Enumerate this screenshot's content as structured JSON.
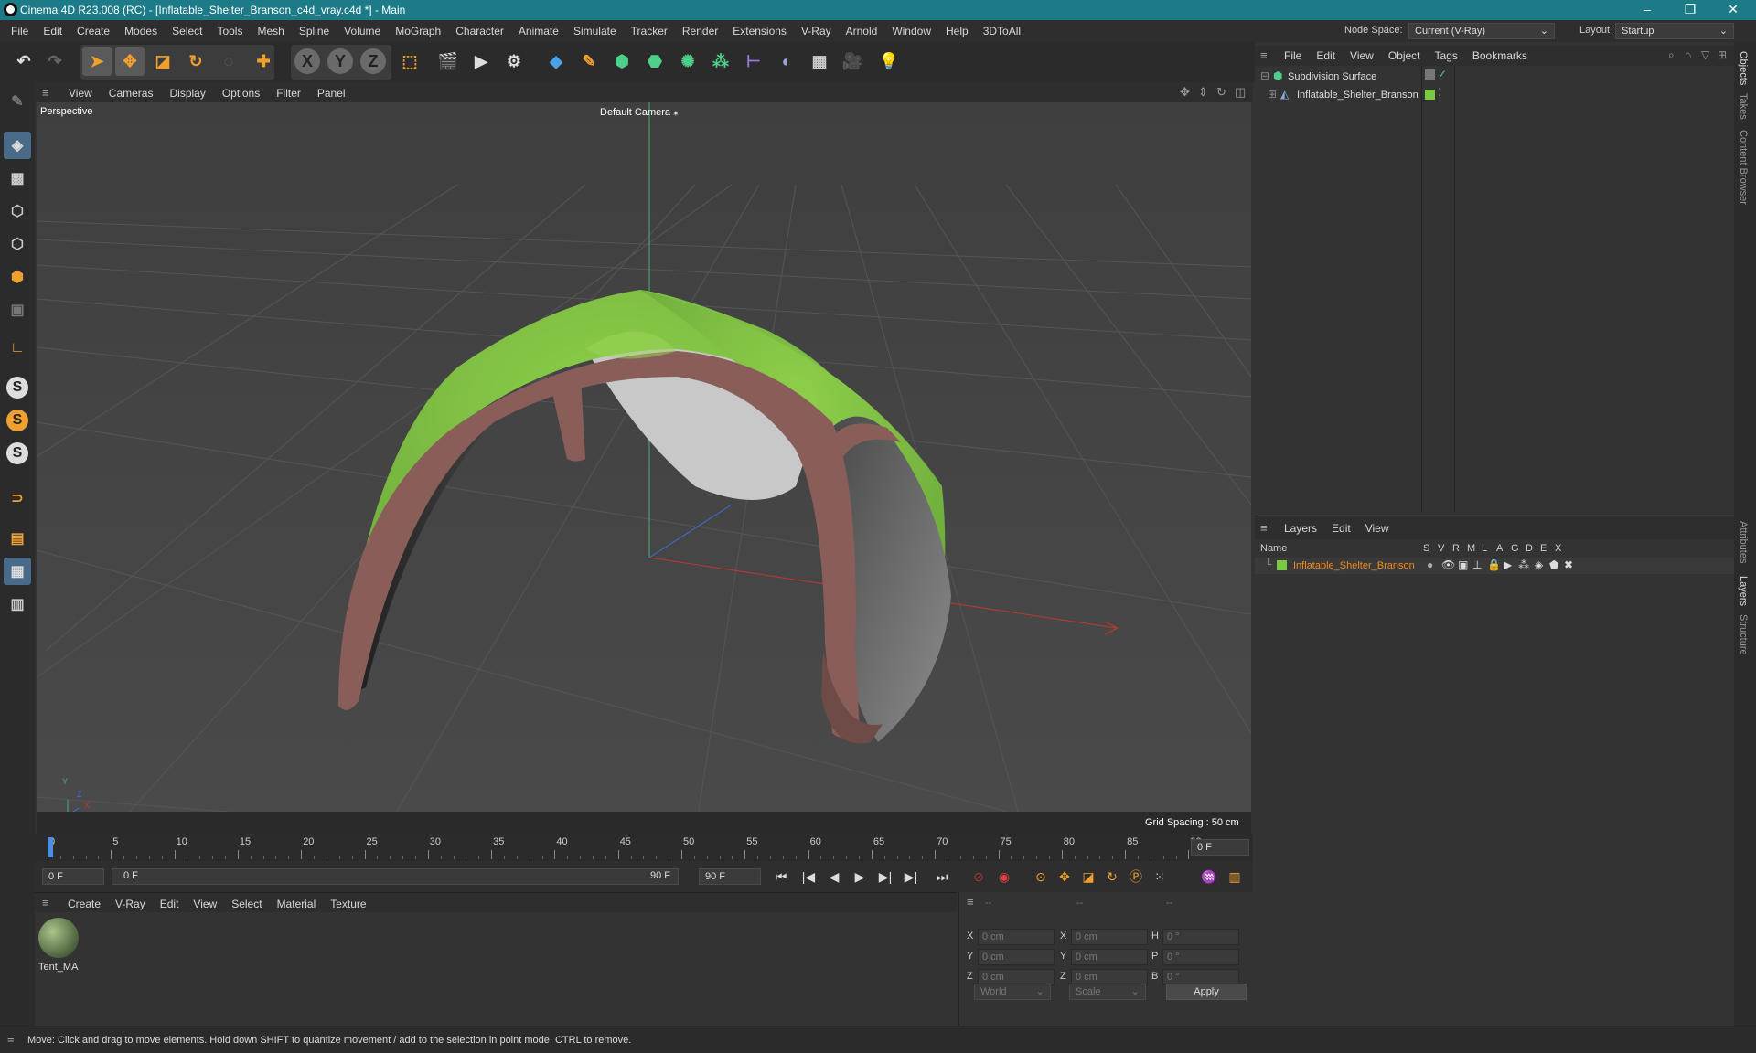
{
  "window": {
    "title": "Cinema 4D R23.008 (RC) - [Inflatable_Shelter_Branson_c4d_vray.c4d *] - Main",
    "min": "–",
    "max": "❐",
    "close": "✕"
  },
  "menubar": {
    "items": [
      "File",
      "Edit",
      "Create",
      "Modes",
      "Select",
      "Tools",
      "Mesh",
      "Spline",
      "Volume",
      "MoGraph",
      "Character",
      "Animate",
      "Simulate",
      "Tracker",
      "Render",
      "Extensions",
      "V-Ray",
      "Arnold",
      "Window",
      "Help",
      "3DToAll"
    ],
    "node_space_label": "Node Space:",
    "node_space_value": "Current (V-Ray)",
    "layout_label": "Layout:",
    "layout_value": "Startup"
  },
  "toolbar": {
    "axis_x": "X",
    "axis_y": "Y",
    "axis_z": "Z"
  },
  "leftbar": {
    "s1": "S",
    "s2": "S",
    "s3": "S"
  },
  "viewport": {
    "menu": [
      "View",
      "Cameras",
      "Display",
      "Options",
      "Filter",
      "Panel"
    ],
    "view_name": "Perspective",
    "camera": "Default Camera",
    "grid_spacing": "Grid Spacing : 50 cm",
    "axis_y": "Y",
    "axis_z": "Z",
    "axis_x": "X"
  },
  "timeline": {
    "ticks": [
      "0",
      "5",
      "10",
      "15",
      "20",
      "25",
      "30",
      "35",
      "40",
      "45",
      "50",
      "55",
      "60",
      "65",
      "70",
      "75",
      "80",
      "85",
      "90"
    ],
    "frame_end_field": "0 F"
  },
  "transport": {
    "start_field": "0 F",
    "range_start": "0 F",
    "range_end": "90 F",
    "end_field": "90 F"
  },
  "material_manager": {
    "menu": [
      "Create",
      "V-Ray",
      "Edit",
      "View",
      "Select",
      "Material",
      "Texture"
    ],
    "materials": [
      {
        "name": "Tent_MA"
      }
    ]
  },
  "coordinates": {
    "header": [
      "--",
      "--",
      "--"
    ],
    "rows": [
      {
        "l1": "X",
        "v1": "0 cm",
        "l2": "X",
        "v2": "0 cm",
        "l3": "H",
        "v3": "0 °"
      },
      {
        "l1": "Y",
        "v1": "0 cm",
        "l2": "Y",
        "v2": "0 cm",
        "l3": "P",
        "v3": "0 °"
      },
      {
        "l1": "Z",
        "v1": "0 cm",
        "l2": "Z",
        "v2": "0 cm",
        "l3": "B",
        "v3": "0 °"
      }
    ],
    "space": "World",
    "mode": "Scale",
    "apply": "Apply"
  },
  "object_manager": {
    "menu": [
      "File",
      "Edit",
      "View",
      "Object",
      "Tags",
      "Bookmarks"
    ],
    "objects": [
      {
        "name": "Subdivision Surface"
      },
      {
        "name": "Inflatable_Shelter_Branson"
      }
    ]
  },
  "layer_manager": {
    "menu": [
      "Layers",
      "Edit",
      "View"
    ],
    "col_name": "Name",
    "cols": [
      "S",
      "V",
      "R",
      "M",
      "L",
      "A",
      "G",
      "D",
      "E",
      "X"
    ],
    "layers": [
      {
        "name": "Inflatable_Shelter_Branson",
        "color": "#7ac943"
      }
    ]
  },
  "sidetabs": [
    "Objects",
    "Takes",
    "Content Browser",
    "Attributes",
    "Layers",
    "Structure"
  ],
  "status": "Move: Click and drag to move elements. Hold down SHIFT to quantize movement / add to the selection in point mode, CTRL to remove.",
  "colors": {
    "accent": "#1d7b87",
    "layer_orange": "#f08a1c",
    "tent_green": "#7ab843"
  }
}
